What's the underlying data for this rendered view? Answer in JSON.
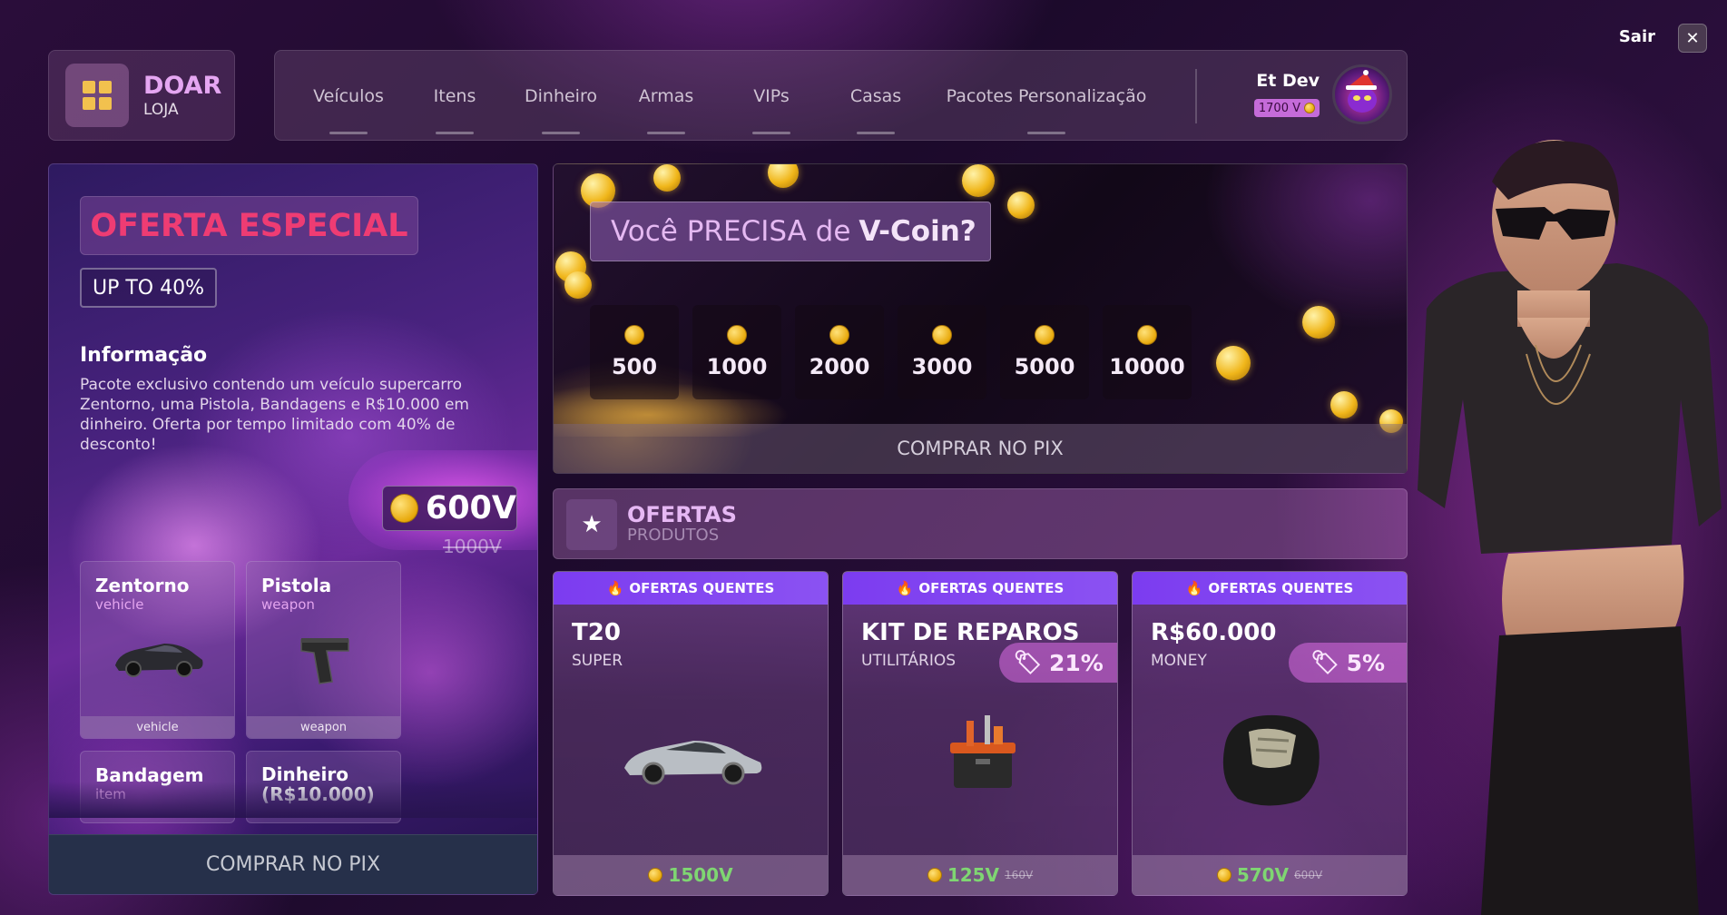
{
  "logo": {
    "title": "DOAR",
    "subtitle": "LOJA",
    "icon": "grid-icon"
  },
  "nav": {
    "items": [
      "Veículos",
      "Itens",
      "Dinheiro",
      "Armas",
      "VIPs",
      "Casas",
      "Pacotes Personalização"
    ]
  },
  "user": {
    "name": "Et Dev",
    "balance": "1700 V"
  },
  "exit": {
    "label": "Sair",
    "close": "✕"
  },
  "special": {
    "title": "OFERTA ESPECIAL",
    "upto": "UP TO 40%",
    "info_title": "Informação",
    "info_text": "Pacote exclusivo contendo um veículo supercarro Zentorno, uma Pistola, Bandagens e R$10.000 em dinheiro. Oferta por tempo limitado com 40% de desconto!",
    "price": "600V",
    "old_price": "1000V",
    "items": [
      {
        "name": "Zentorno",
        "type": "vehicle",
        "footer": "vehicle"
      },
      {
        "name": "Pistola",
        "type": "weapon",
        "footer": "weapon"
      },
      {
        "name": "Bandagem",
        "type": "item",
        "footer": ""
      },
      {
        "name": "Dinheiro (R$10.000)",
        "type": "",
        "footer": ""
      }
    ],
    "buy_label": "COMPRAR NO PIX"
  },
  "vcoin": {
    "title_a": "Você PRECISA de",
    "title_b": "V-Coin?",
    "packages": [
      "500",
      "1000",
      "2000",
      "3000",
      "5000",
      "10000"
    ],
    "buy_label": "COMPRAR NO PIX"
  },
  "offers": {
    "title": "OFERTAS",
    "subtitle": "PRODUTOS",
    "icon": "star-icon"
  },
  "products": [
    {
      "hot": "OFERTAS QUENTES",
      "name": "T20",
      "category": "SUPER",
      "discount": "",
      "price": "1500V",
      "old_price": ""
    },
    {
      "hot": "OFERTAS QUENTES",
      "name": "KIT DE REPAROS",
      "category": "UTILITÁRIOS",
      "discount": "21%",
      "price": "125V",
      "old_price": "160V"
    },
    {
      "hot": "OFERTAS QUENTES",
      "name": "R$60.000",
      "category": "MONEY",
      "discount": "5%",
      "price": "570V",
      "old_price": "600V"
    }
  ],
  "colors": {
    "accent": "#ee3c73",
    "hot_bar": "#7c3cf0",
    "price_green": "#7fd672",
    "coin": "#f2c14e"
  }
}
